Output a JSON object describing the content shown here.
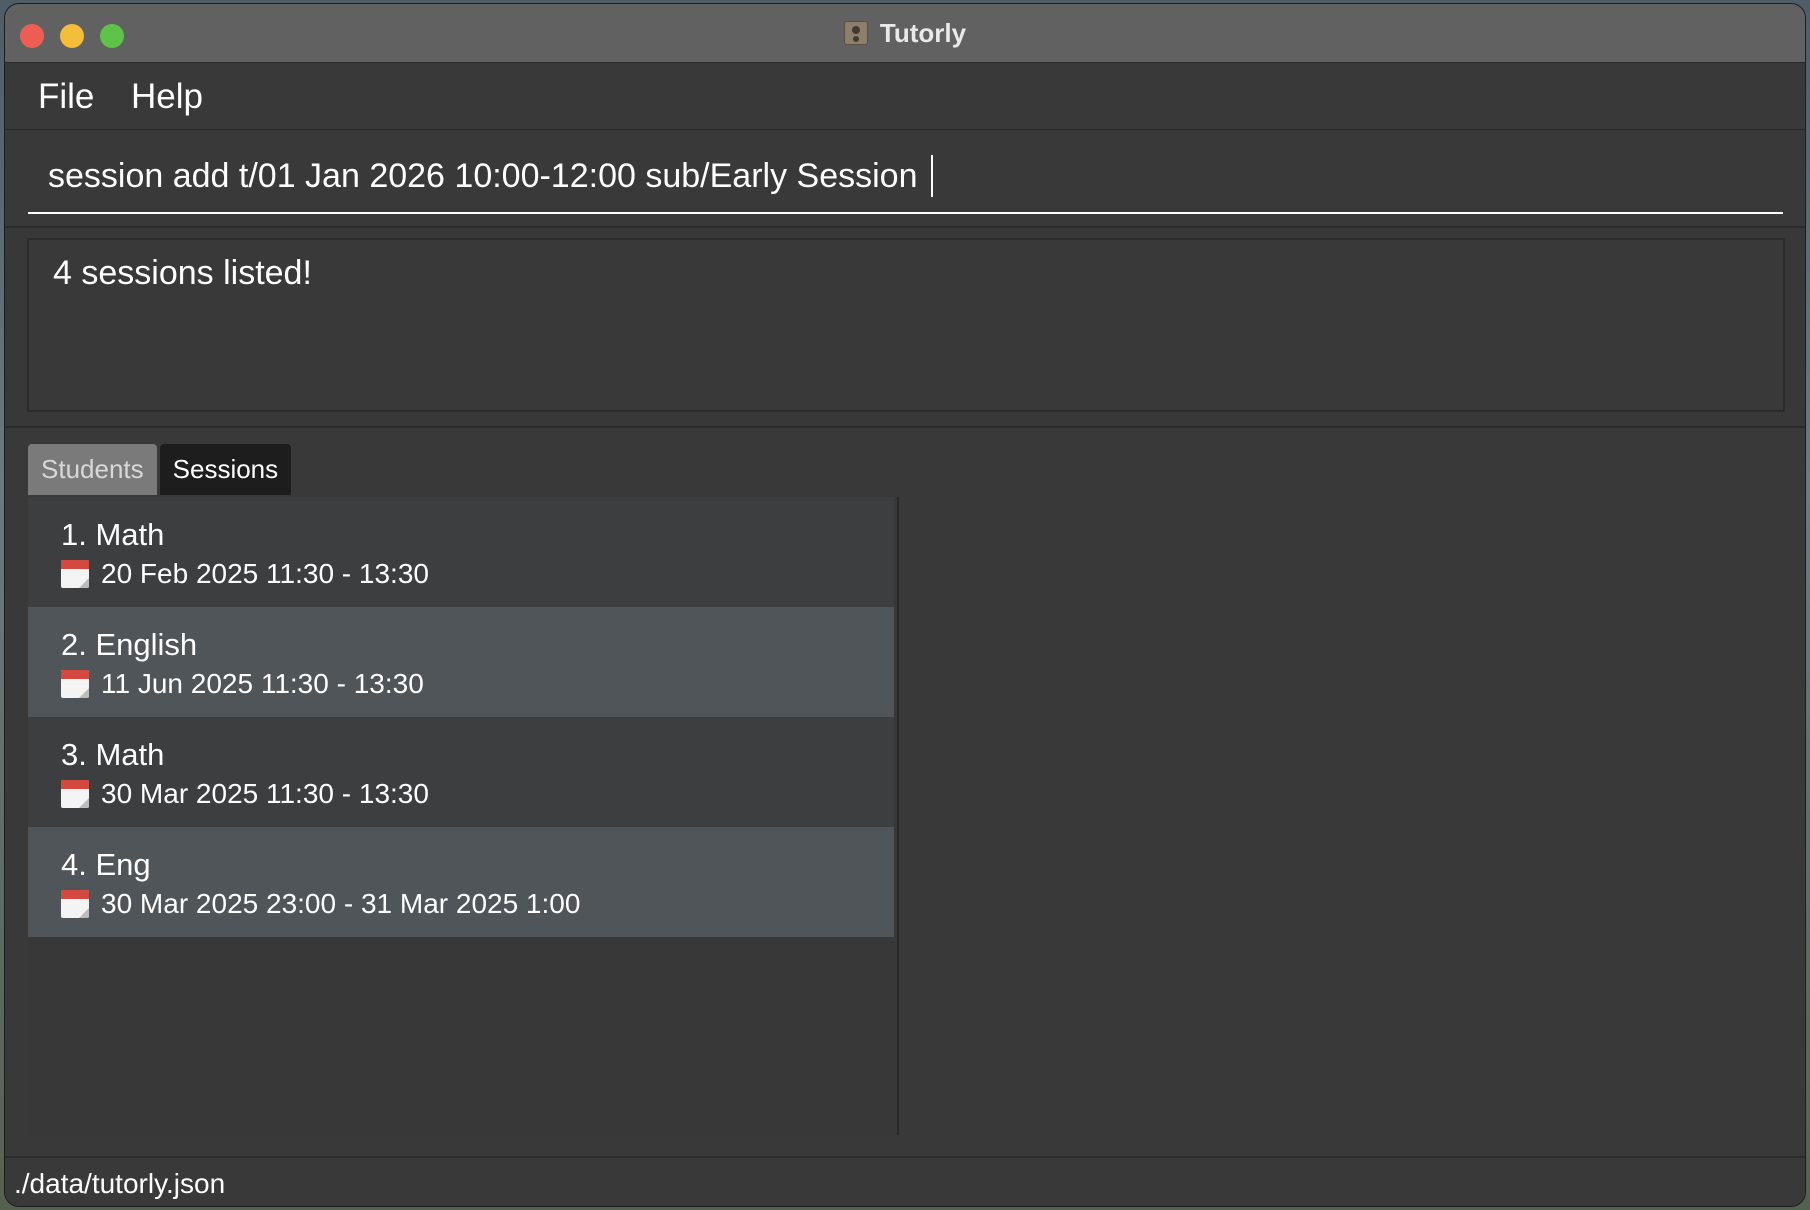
{
  "window": {
    "title": "Tutorly",
    "app_icon": "contact-book-icon"
  },
  "menubar": {
    "file_label": "File",
    "help_label": "Help"
  },
  "command": {
    "value": "session add t/01 Jan 2026 10:00-12:00 sub/Early Session"
  },
  "result": {
    "message": "4 sessions listed!"
  },
  "tabs": [
    {
      "label": "Students",
      "selected": false
    },
    {
      "label": "Sessions",
      "selected": true
    }
  ],
  "sessions": [
    {
      "title": "1. Math",
      "time": "20 Feb 2025 11:30 - 13:30"
    },
    {
      "title": "2. English",
      "time": "11 Jun 2025 11:30 - 13:30"
    },
    {
      "title": "3. Math",
      "time": "30 Mar 2025 11:30 - 13:30"
    },
    {
      "title": "4. Eng",
      "time": "30 Mar 2025 23:00 - 31 Mar 2025 1:00"
    }
  ],
  "status": {
    "file_path": "./data/tutorly.json"
  },
  "icons": {
    "session_time": "calendar-icon"
  },
  "colors": {
    "window_bg": "#393939",
    "titlebar_bg": "#616161",
    "selected_tab_bg": "#1d1d1d",
    "unselected_tab_bg": "#7a7a7a",
    "card_odd_bg": "#3c3e3f",
    "card_even_bg": "#4f5558",
    "close": "#ee5d53",
    "minimize": "#f4bd3a",
    "maximize": "#5fc34a"
  }
}
